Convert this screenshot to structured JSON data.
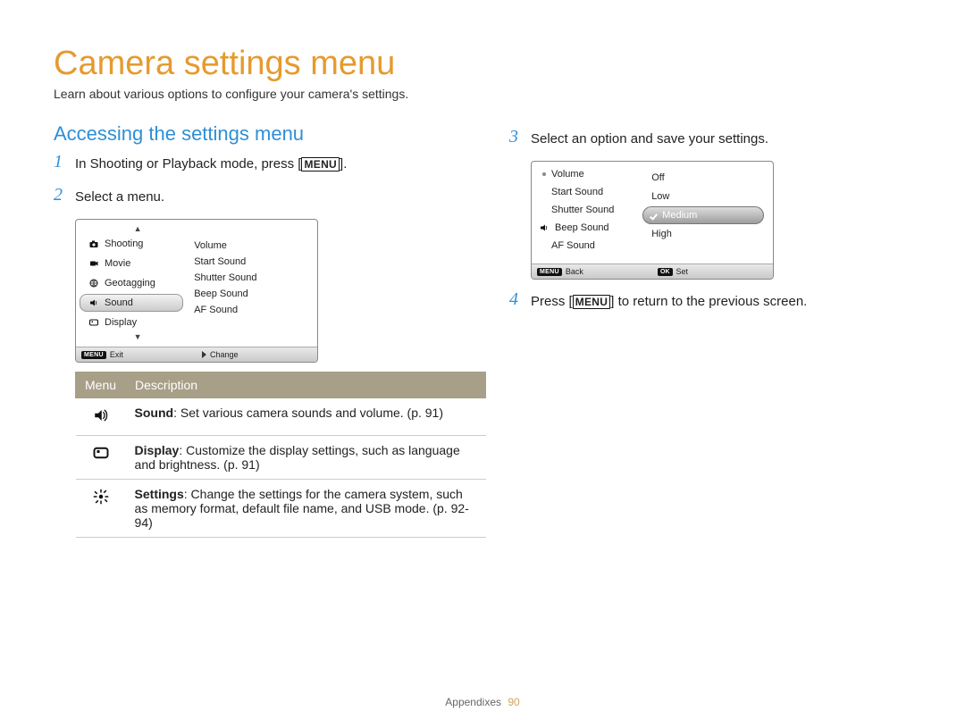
{
  "title": "Camera settings menu",
  "intro": "Learn about various options to configure your camera's settings.",
  "subhead": "Accessing the settings menu",
  "steps": {
    "s1a": "In Shooting or Playback mode, press [",
    "s1b": "MENU",
    "s1c": "].",
    "s2": "Select a menu.",
    "s3": "Select an option and save your settings.",
    "s4a": "Press [",
    "s4b": "MENU",
    "s4c": "] to return to the previous screen."
  },
  "screen1": {
    "left": [
      "Shooting",
      "Movie",
      "Geotagging",
      "Sound",
      "Display"
    ],
    "right": [
      "Volume",
      "Start Sound",
      "Shutter Sound",
      "Beep Sound",
      "AF Sound"
    ],
    "footer": {
      "exit_label": "Exit",
      "change_label": "Change",
      "menu_badge": "MENU"
    }
  },
  "table": {
    "head": {
      "menu": "Menu",
      "desc": "Description"
    },
    "rows": [
      {
        "name": "Sound",
        "desc": ": Set various camera sounds and volume. (p. 91)"
      },
      {
        "name": "Display",
        "desc": ": Customize the display settings, such as language and brightness. (p. 91)"
      },
      {
        "name": "Settings",
        "desc": ": Change the settings for the camera system, such as memory format, default file name, and USB mode. (p. 92-94)"
      }
    ]
  },
  "screen2": {
    "left": [
      "Volume",
      "Start Sound",
      "Shutter Sound",
      "Beep Sound",
      "AF Sound"
    ],
    "options": [
      "Off",
      "Low",
      "Medium",
      "High"
    ],
    "selected": "Medium",
    "footer": {
      "back_label": "Back",
      "set_label": "Set",
      "menu_badge": "MENU",
      "ok_badge": "OK"
    }
  },
  "footer": {
    "section": "Appendixes",
    "page": "90"
  }
}
